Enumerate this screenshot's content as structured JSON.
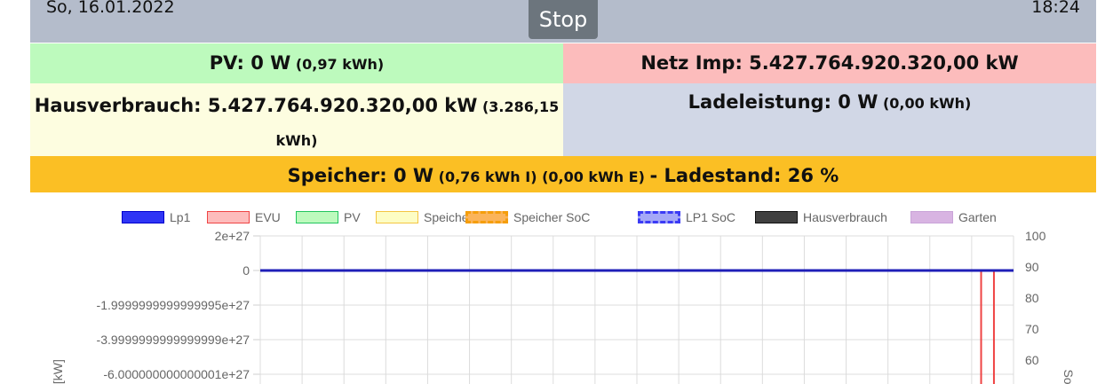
{
  "header": {
    "date": "So, 16.01.2022",
    "stop_label": "Stop",
    "time": "18:24"
  },
  "summary": {
    "pv_main": "PV: 0 W",
    "pv_detail": "(0,97 kWh)",
    "netz_main": "Netz Imp: 5.427.764.920.320,00 kW",
    "haus_main": "Hausverbrauch: 5.427.764.920.320,00 kW",
    "haus_detail_1": "(3.286,15",
    "haus_detail_2": "kWh)",
    "lade_main": "Ladeleistung: 0 W",
    "lade_detail": "(0,00 kWh)",
    "speicher_main": "Speicher: 0 W",
    "speicher_detail": "(0,76 kWh I) (0,00 kWh E)",
    "speicher_soc": "- Ladestand: 26 %"
  },
  "colors": {
    "header_bg": "#b4bccb",
    "pv_bg": "#bdfabd",
    "netz_bg": "#fcbcbc",
    "haus_bg": "#fdfde0",
    "lade_bg": "#d1d7e6",
    "speicher_bg": "#fbbf24",
    "stop_bg": "#6c757d"
  },
  "chart_data": {
    "type": "line",
    "legend": [
      {
        "name": "Lp1",
        "fill": "#2f35f5",
        "border": "#0000cc",
        "dashed": false
      },
      {
        "name": "EVU",
        "fill": "#fdbcbc",
        "border": "#ef4444",
        "dashed": false
      },
      {
        "name": "PV",
        "fill": "#bdfabd",
        "border": "#22c55e",
        "dashed": false
      },
      {
        "name": "Speicher",
        "fill": "#fdfdc4",
        "border": "#f4c542",
        "dashed": false
      },
      {
        "name": "Speicher SoC",
        "fill": "#fbb45a",
        "border": "#f59e0b",
        "dashed": true
      },
      {
        "name": "LP1 SoC",
        "fill": "#a5a8f7",
        "border": "#3b3bf5",
        "dashed": true
      },
      {
        "name": "Hausverbrauch",
        "fill": "#404040",
        "border": "#111111",
        "dashed": false
      },
      {
        "name": "Garten",
        "fill": "#d8b4e2",
        "border": "#c9a4d8",
        "dashed": false
      }
    ],
    "y_left_ticks": [
      "2e+27",
      "0",
      "-1.9999999999999995e+27",
      "-3.9999999999999999e+27",
      "-6.000000000000001e+27"
    ],
    "y_left_values": [
      2e+27,
      0,
      -2e+27,
      -4e+27,
      -6e+27
    ],
    "y_left_label": "g [kW]",
    "y_right_ticks": [
      "100",
      "90",
      "80",
      "70",
      "60"
    ],
    "y_right_values": [
      100,
      90,
      80,
      70,
      60
    ],
    "y_right_label": "So",
    "x_grid_count": 18,
    "series": [
      {
        "name": "Lp1",
        "color": "#1f1fb8",
        "points_frac": [
          [
            0,
            0
          ],
          [
            1,
            0
          ]
        ]
      },
      {
        "name": "EVU",
        "color": "#ef4444",
        "spikes_frac": [
          0.957,
          0.974
        ]
      }
    ]
  }
}
